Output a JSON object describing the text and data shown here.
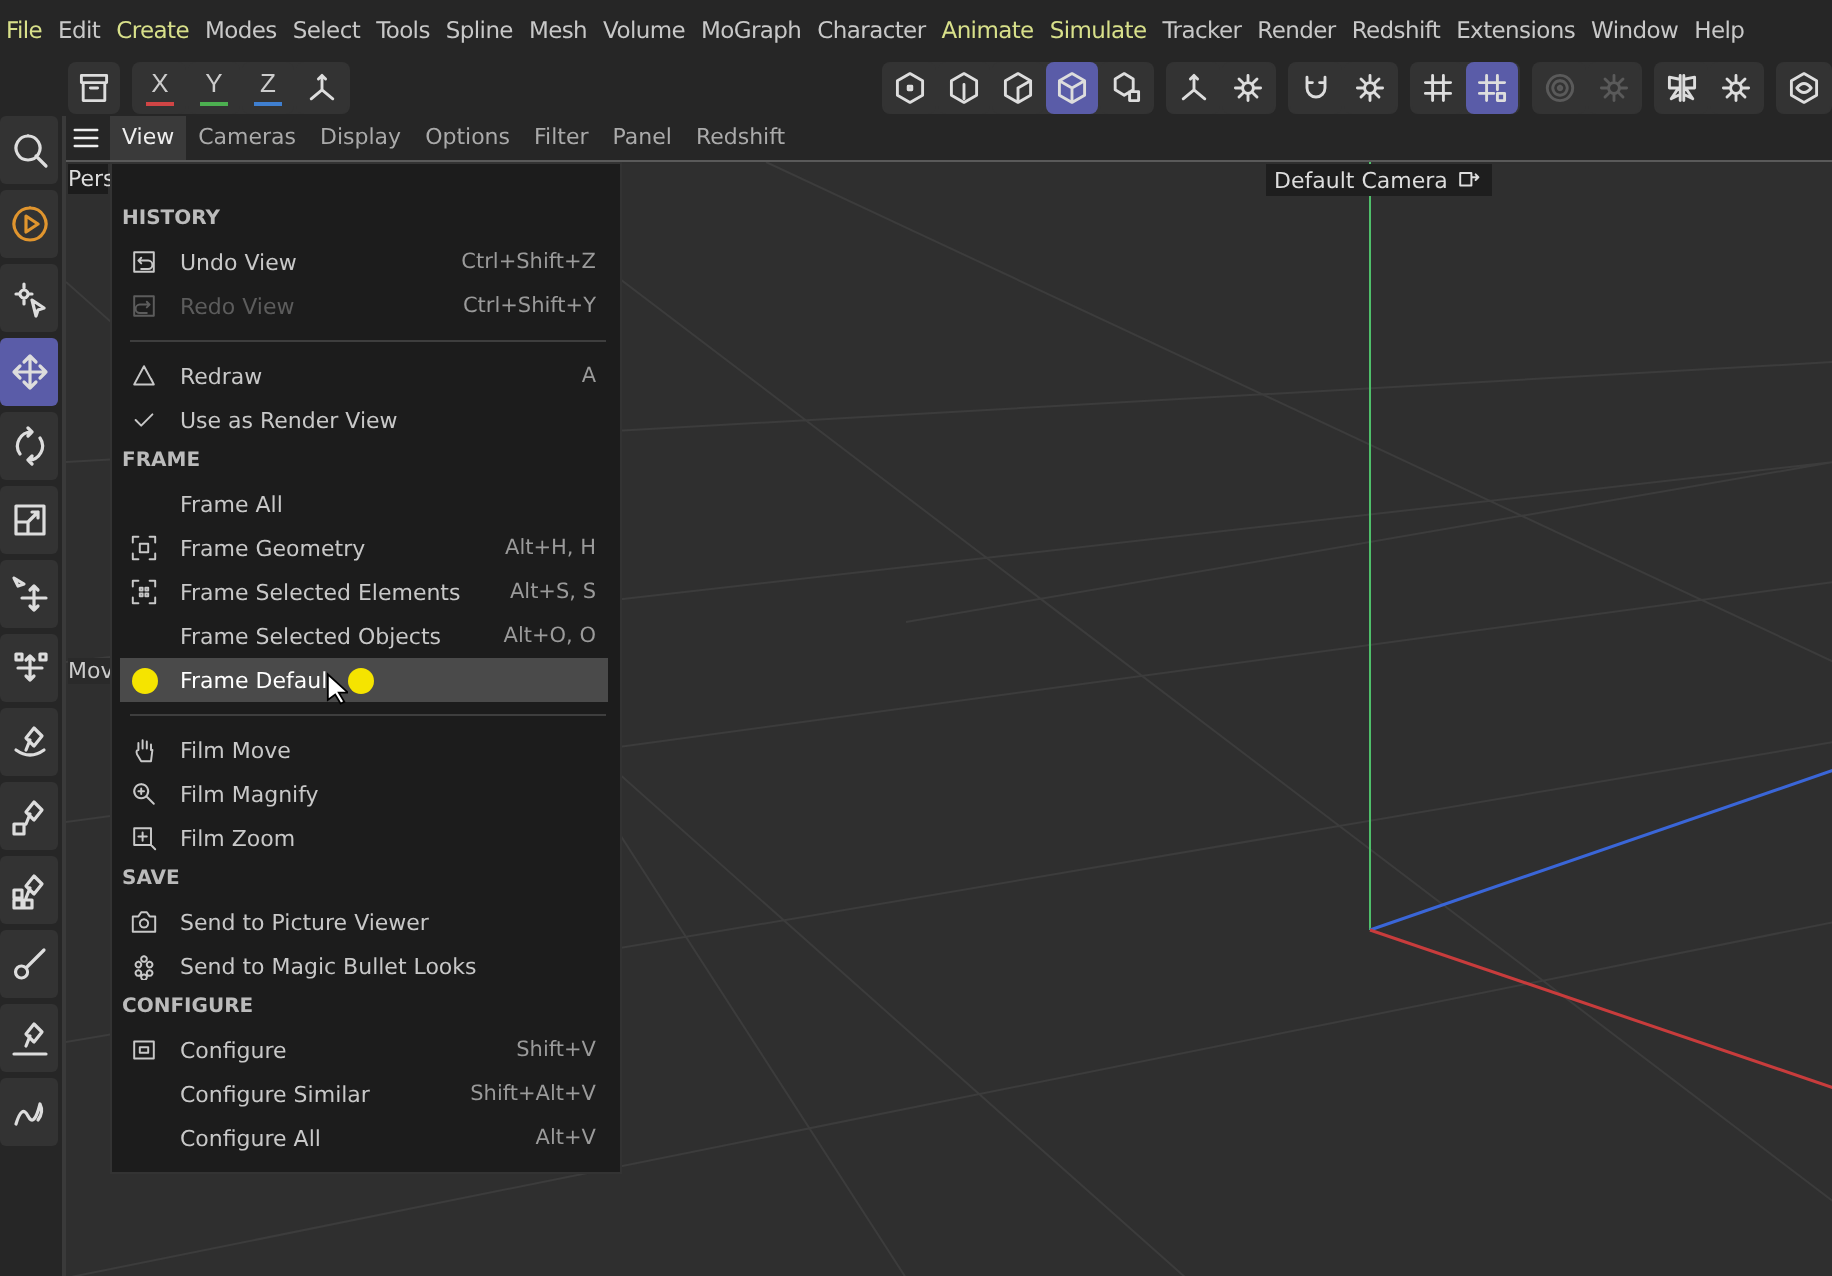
{
  "menubar": [
    {
      "label": "File",
      "highlighted": true
    },
    {
      "label": "Edit",
      "highlighted": false
    },
    {
      "label": "Create",
      "highlighted": true
    },
    {
      "label": "Modes",
      "highlighted": false
    },
    {
      "label": "Select",
      "highlighted": false
    },
    {
      "label": "Tools",
      "highlighted": false
    },
    {
      "label": "Spline",
      "highlighted": false
    },
    {
      "label": "Mesh",
      "highlighted": false
    },
    {
      "label": "Volume",
      "highlighted": false
    },
    {
      "label": "MoGraph",
      "highlighted": false
    },
    {
      "label": "Character",
      "highlighted": false
    },
    {
      "label": "Animate",
      "highlighted": true
    },
    {
      "label": "Simulate",
      "highlighted": true
    },
    {
      "label": "Tracker",
      "highlighted": false
    },
    {
      "label": "Render",
      "highlighted": false
    },
    {
      "label": "Redshift",
      "highlighted": false
    },
    {
      "label": "Extensions",
      "highlighted": false
    },
    {
      "label": "Window",
      "highlighted": false
    },
    {
      "label": "Help",
      "highlighted": false
    }
  ],
  "toolbar": {
    "axes": [
      {
        "label": "X",
        "color": "#d04545"
      },
      {
        "label": "Y",
        "color": "#4caf50"
      },
      {
        "label": "Z",
        "color": "#3f7fd0"
      }
    ],
    "groups": [
      [
        {
          "selected": false,
          "disabled": false
        },
        {
          "selected": false,
          "disabled": false
        },
        {
          "selected": false,
          "disabled": false
        },
        {
          "selected": true,
          "disabled": false
        },
        {
          "selected": false,
          "disabled": false
        }
      ],
      [
        {
          "selected": false,
          "disabled": false
        },
        {
          "selected": false,
          "disabled": false
        }
      ],
      [
        {
          "selected": false,
          "disabled": false
        },
        {
          "selected": false,
          "disabled": false
        }
      ],
      [
        {
          "selected": false,
          "disabled": false
        },
        {
          "selected": true,
          "disabled": false
        }
      ],
      [
        {
          "selected": false,
          "disabled": true
        },
        {
          "selected": false,
          "disabled": true
        }
      ],
      [
        {
          "selected": false,
          "disabled": false
        },
        {
          "selected": false,
          "disabled": false
        }
      ],
      [
        {
          "selected": false,
          "disabled": false
        }
      ]
    ]
  },
  "left_tools": [
    {
      "selected": false
    },
    {
      "selected": false
    },
    {
      "selected": false
    },
    {
      "selected": true
    },
    {
      "selected": false
    },
    {
      "selected": false
    },
    {
      "selected": false
    },
    {
      "selected": false
    },
    {
      "selected": false
    },
    {
      "selected": false
    },
    {
      "selected": false
    },
    {
      "selected": false
    },
    {
      "selected": false
    },
    {
      "selected": false
    }
  ],
  "viewport": {
    "tabs": [
      {
        "label": "View",
        "selected": true
      },
      {
        "label": "Cameras",
        "selected": false
      },
      {
        "label": "Display",
        "selected": false
      },
      {
        "label": "Options",
        "selected": false
      },
      {
        "label": "Filter",
        "selected": false
      },
      {
        "label": "Panel",
        "selected": false
      },
      {
        "label": "Redshift",
        "selected": false
      }
    ],
    "view_label": "Pers",
    "camera_label": "Default Camera",
    "hud_label": "Mov"
  },
  "view_menu": [
    {
      "kind": "header",
      "label": "HISTORY"
    },
    {
      "kind": "item",
      "label": "Undo View",
      "shortcut": "Ctrl+Shift+Z",
      "disabled": false,
      "checked": false,
      "selected": false
    },
    {
      "kind": "item",
      "label": "Redo View",
      "shortcut": "Ctrl+Shift+Y",
      "disabled": true,
      "checked": false,
      "selected": false
    },
    {
      "kind": "separator"
    },
    {
      "kind": "item",
      "label": "Redraw",
      "shortcut": "A",
      "disabled": false,
      "checked": false,
      "selected": false
    },
    {
      "kind": "item",
      "label": "Use as Render View",
      "disabled": false,
      "checked": true,
      "selected": false
    },
    {
      "kind": "header",
      "label": "FRAME"
    },
    {
      "kind": "item",
      "label": "Frame All",
      "disabled": false,
      "checked": false,
      "selected": false
    },
    {
      "kind": "item",
      "label": "Frame Geometry",
      "shortcut": "Alt+H, H",
      "disabled": false,
      "checked": false,
      "selected": false
    },
    {
      "kind": "item",
      "label": "Frame Selected Elements",
      "shortcut": "Alt+S, S",
      "disabled": false,
      "checked": false,
      "selected": false
    },
    {
      "kind": "item",
      "label": "Frame Selected Objects",
      "shortcut": "Alt+O, O",
      "disabled": false,
      "checked": false,
      "selected": false
    },
    {
      "kind": "item",
      "label": "Frame Defaul",
      "disabled": false,
      "checked": false,
      "selected": true
    },
    {
      "kind": "separator"
    },
    {
      "kind": "item",
      "label": "Film Move",
      "disabled": false,
      "checked": false,
      "selected": false
    },
    {
      "kind": "item",
      "label": "Film Magnify",
      "disabled": false,
      "checked": false,
      "selected": false
    },
    {
      "kind": "item",
      "label": "Film Zoom",
      "disabled": false,
      "checked": false,
      "selected": false
    },
    {
      "kind": "header",
      "label": "SAVE"
    },
    {
      "kind": "item",
      "label": "Send to Picture Viewer",
      "disabled": false,
      "checked": false,
      "selected": false
    },
    {
      "kind": "item",
      "label": "Send to Magic Bullet Looks",
      "disabled": false,
      "checked": false,
      "selected": false
    },
    {
      "kind": "header",
      "label": "CONFIGURE"
    },
    {
      "kind": "item",
      "label": "Configure",
      "shortcut": "Shift+V",
      "disabled": false,
      "checked": false,
      "selected": false
    },
    {
      "kind": "item",
      "label": "Configure Similar",
      "shortcut": "Shift+Alt+V",
      "disabled": false,
      "checked": false,
      "selected": false
    },
    {
      "kind": "item",
      "label": "Configure All",
      "shortcut": "Alt+V",
      "disabled": false,
      "checked": false,
      "selected": false
    }
  ]
}
